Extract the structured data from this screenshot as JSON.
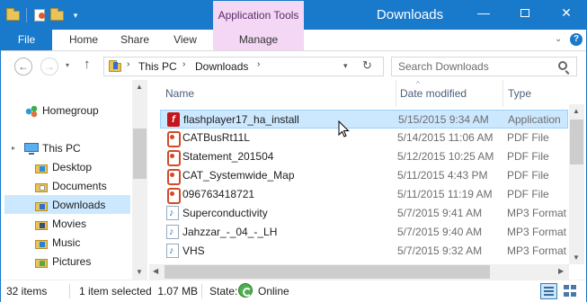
{
  "window": {
    "title": "Downloads",
    "contextual_group": "Application Tools",
    "caption_buttons": {
      "minimize": "—",
      "maximize": "",
      "close": "✕"
    }
  },
  "ribbon": {
    "tabs": [
      {
        "label": "File"
      },
      {
        "label": "Home"
      },
      {
        "label": "Share"
      },
      {
        "label": "View"
      },
      {
        "label": "Manage"
      }
    ],
    "expand_glyph": "⌄",
    "help_glyph": "?"
  },
  "address": {
    "crumbs": [
      "This PC",
      "Downloads"
    ],
    "separator_glyph": "›",
    "search_placeholder": "Search Downloads",
    "back_glyph": "←",
    "forward_glyph": "→",
    "up_glyph": "↑",
    "refresh_glyph": "↻",
    "dropdown_glyph": "▾"
  },
  "nav_pane": {
    "items": [
      {
        "label": "Homegroup",
        "icon": "homegroup-icon"
      },
      {
        "label": "This PC",
        "icon": "computer-icon"
      },
      {
        "label": "Desktop",
        "icon": "desktop-folder-icon"
      },
      {
        "label": "Documents",
        "icon": "documents-folder-icon"
      },
      {
        "label": "Downloads",
        "icon": "downloads-folder-icon",
        "selected": true
      },
      {
        "label": "Movies",
        "icon": "movies-folder-icon"
      },
      {
        "label": "Music",
        "icon": "music-folder-icon"
      },
      {
        "label": "Pictures",
        "icon": "pictures-folder-icon"
      }
    ],
    "expand_glyph": "▸"
  },
  "file_list": {
    "columns": [
      "Name",
      "Date modified",
      "Type"
    ],
    "sort_glyph": "^",
    "rows": [
      {
        "name": "flashplayer17_ha_install",
        "date": "5/15/2015 9:34 AM",
        "type": "Application",
        "icon": "flash-installer-icon",
        "selected": true
      },
      {
        "name": "CATBusRt11L",
        "date": "5/14/2015 11:06 AM",
        "type": "PDF File",
        "icon": "pdf-file-icon"
      },
      {
        "name": "Statement_201504",
        "date": "5/12/2015 10:25 AM",
        "type": "PDF File",
        "icon": "pdf-file-icon"
      },
      {
        "name": "CAT_Systemwide_Map",
        "date": "5/11/2015 4:43 PM",
        "type": "PDF File",
        "icon": "pdf-file-icon"
      },
      {
        "name": "096763418721",
        "date": "5/11/2015 11:19 AM",
        "type": "PDF File",
        "icon": "pdf-file-icon"
      },
      {
        "name": "Superconductivity",
        "date": "5/7/2015 9:41 AM",
        "type": "MP3 Format",
        "icon": "mp3-file-icon"
      },
      {
        "name": "Jahzzar_-_04_-_LH",
        "date": "5/7/2015 9:40 AM",
        "type": "MP3 Format",
        "icon": "mp3-file-icon"
      },
      {
        "name": "VHS",
        "date": "5/7/2015 9:32 AM",
        "type": "MP3 Format",
        "icon": "mp3-file-icon"
      }
    ]
  },
  "status": {
    "item_count": "32 items",
    "selection": "1 item selected  1.07 MB",
    "state_label": "State:",
    "state_value": "Online"
  },
  "colors": {
    "titlebar": "#1979ca",
    "contextual_tab": "#f3d7f4",
    "selection": "#cce8ff"
  }
}
